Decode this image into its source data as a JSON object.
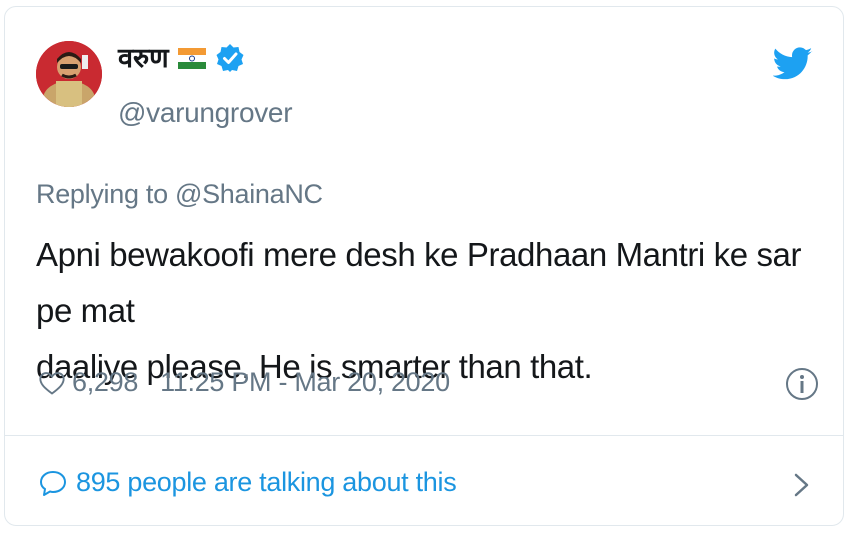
{
  "tweet": {
    "display_name": "वरुण",
    "handle": "@varungrover",
    "replying_to": "Replying to @ShainaNC",
    "text_line1": "Apni bewakoofi mere desh ke Pradhaan Mantri ke sar pe mat",
    "text_line2": "daaliye please. He is smarter than that.",
    "likes": "6,298",
    "timestamp": "11:25 PM - Mar 20, 2020",
    "talking": "895 people are talking about this"
  },
  "icons": {
    "flag": "india-flag-icon",
    "verified": "verified-badge-icon",
    "platform": "twitter-bird-icon",
    "like": "heart-icon",
    "info": "info-icon",
    "talk": "speech-bubble-icon",
    "more": "chevron-right-icon"
  },
  "colors": {
    "accent": "#1da1f2",
    "link": "#1b95e0",
    "secondary_text": "#657786",
    "primary_text": "#14171a",
    "border": "#e1e8ed"
  }
}
